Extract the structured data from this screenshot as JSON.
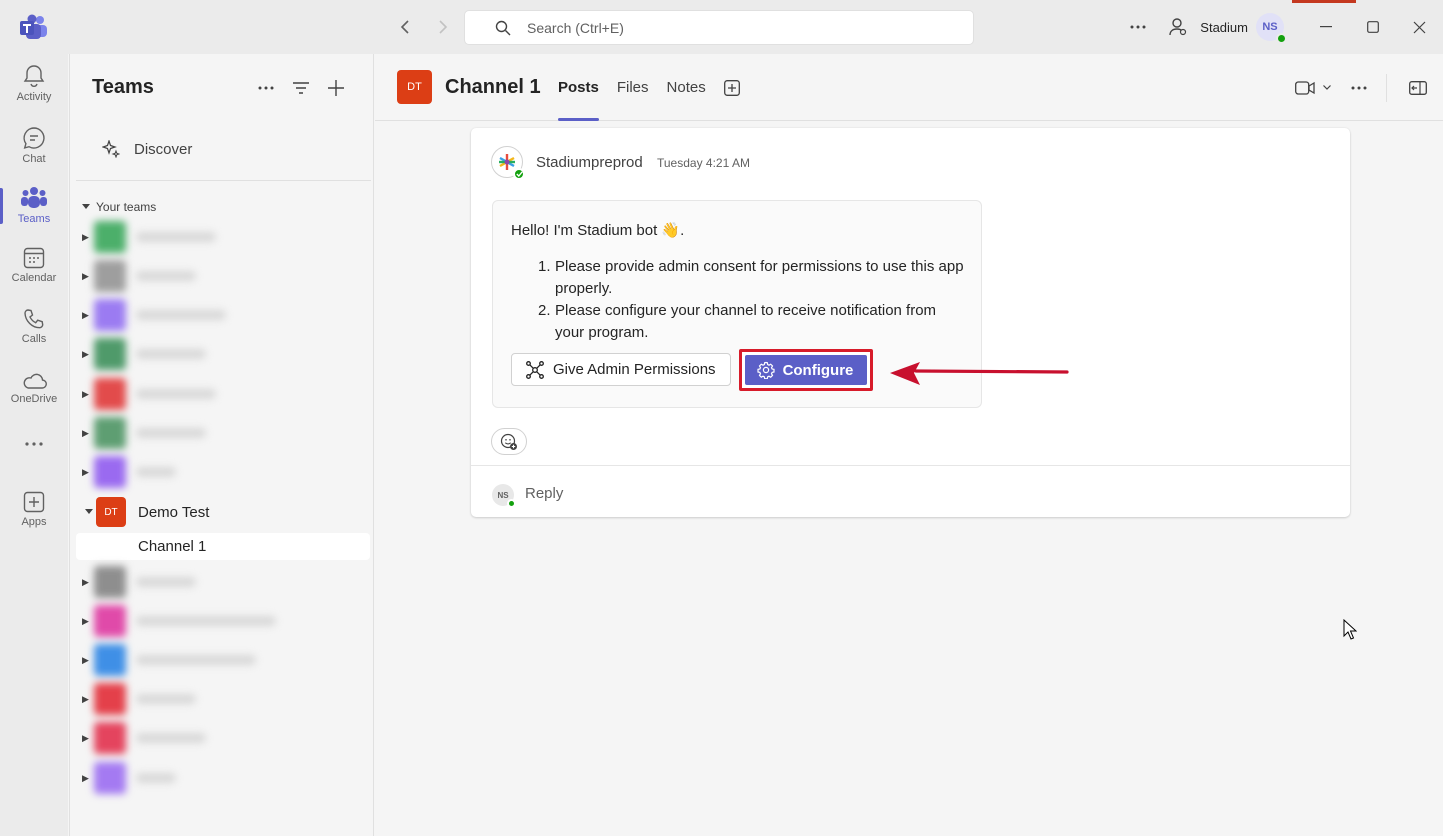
{
  "titlebar": {
    "search_placeholder": "Search (Ctrl+E)",
    "org_name": "Stadium",
    "user_initials": "NS",
    "more_icon": "more-horizontal-icon",
    "people_icon": "people-icon"
  },
  "rail": {
    "items": [
      {
        "label": "Activity",
        "icon": "bell-icon"
      },
      {
        "label": "Chat",
        "icon": "chat-icon"
      },
      {
        "label": "Teams",
        "icon": "teams-icon"
      },
      {
        "label": "Calendar",
        "icon": "calendar-icon"
      },
      {
        "label": "Calls",
        "icon": "phone-icon"
      },
      {
        "label": "OneDrive",
        "icon": "cloud-icon"
      },
      {
        "label": "Apps",
        "icon": "add-app-icon"
      }
    ],
    "active": "Teams"
  },
  "teams_panel": {
    "title": "Teams",
    "discover_label": "Discover",
    "section_label": "Your teams",
    "demo_team": {
      "initials": "DT",
      "name": "Demo Test",
      "channel": "Channel 1"
    }
  },
  "channel_header": {
    "initials": "DT",
    "title": "Channel 1",
    "tabs": [
      "Posts",
      "Files",
      "Notes"
    ],
    "active_tab": "Posts"
  },
  "post": {
    "author": "Stadiumpreprod",
    "timestamp": "Tuesday 4:21 AM",
    "greeting": "Hello! I'm Stadium bot 👋.",
    "steps": [
      {
        "num": "1.",
        "text": "Please provide admin consent for permissions to use this app properly."
      },
      {
        "num": "2.",
        "text": "Please configure your channel to receive notification from your program."
      }
    ],
    "buttons": {
      "admin_label": "Give Admin Permissions",
      "configure_label": "Configure"
    },
    "reply_initials": "NS",
    "reply_label": "Reply"
  },
  "colors": {
    "accent": "#5b5fc7",
    "team_avatar": "#dc3e15",
    "highlight": "#d71b2a",
    "presence": "#13a10e"
  }
}
